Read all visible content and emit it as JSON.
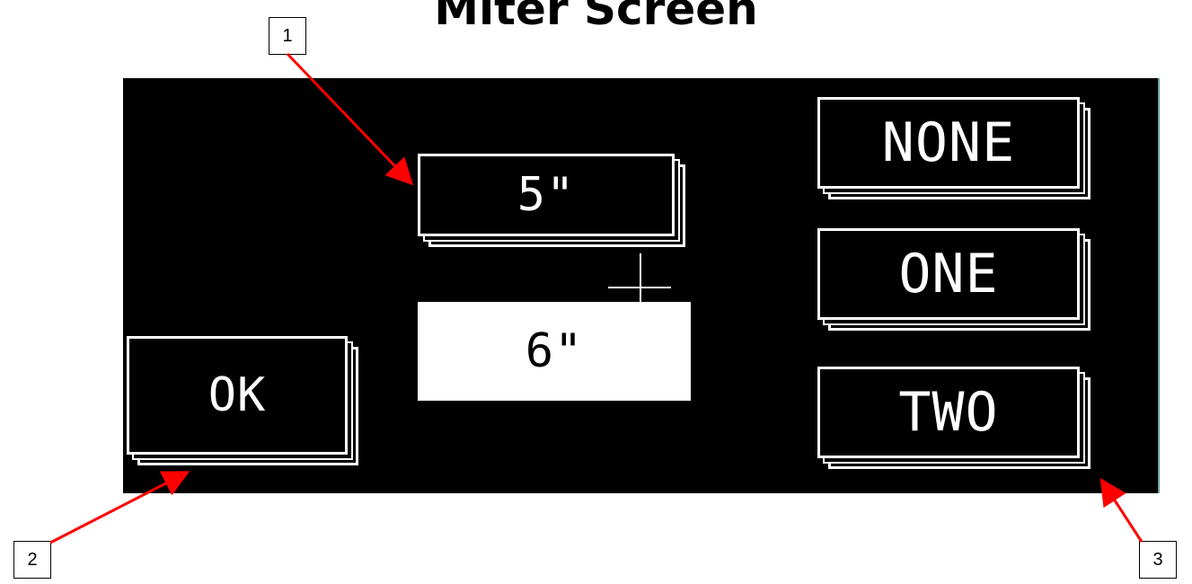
{
  "title": "Miter Screen",
  "screen": {
    "size_buttons": [
      {
        "label": "5\"",
        "selected": false
      },
      {
        "label": "6\"",
        "selected": true
      }
    ],
    "ok_label": "OK",
    "miter_buttons": [
      {
        "label": "NONE"
      },
      {
        "label": "ONE"
      },
      {
        "label": "TWO"
      }
    ]
  },
  "callouts": [
    "1",
    "2",
    "3"
  ],
  "colors": {
    "background": "#000000",
    "foreground": "#ffffff",
    "arrow": "#ff0000"
  }
}
